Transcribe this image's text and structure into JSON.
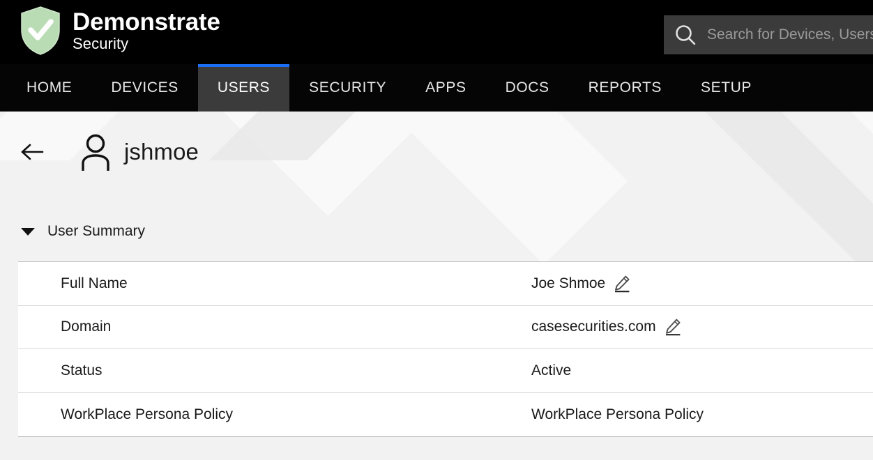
{
  "theme": {
    "accent": "#1c6ef2",
    "header_bg": "#000000",
    "nav_active_bg": "#3b3b3b",
    "shield_green": "#b9dcb4",
    "page_bg": "#f2f2f2",
    "table_bg": "#ffffff"
  },
  "header": {
    "brand_title": "Demonstrate",
    "brand_subtitle": "Security",
    "logo_icon": "shield-check-icon",
    "search": {
      "icon": "search-icon",
      "placeholder": "Search for Devices, Users, Apps...",
      "value": ""
    }
  },
  "nav": {
    "items": [
      {
        "label": "HOME",
        "key": "home",
        "active": false
      },
      {
        "label": "DEVICES",
        "key": "devices",
        "active": false
      },
      {
        "label": "USERS",
        "key": "users",
        "active": true
      },
      {
        "label": "SECURITY",
        "key": "security",
        "active": false
      },
      {
        "label": "APPS",
        "key": "apps",
        "active": false
      },
      {
        "label": "DOCS",
        "key": "docs",
        "active": false
      },
      {
        "label": "REPORTS",
        "key": "reports",
        "active": false
      },
      {
        "label": "SETUP",
        "key": "setup",
        "active": false
      }
    ]
  },
  "page": {
    "back_icon": "arrow-left-icon",
    "avatar_icon": "user-avatar-icon",
    "user_name": "jshmoe",
    "section": {
      "caret_icon": "caret-down-icon",
      "title": "User Summary",
      "expanded": true
    },
    "summary_rows": [
      {
        "label": "Full Name",
        "value": "Joe Shmoe",
        "editable": true,
        "edit_icon": "pencil-edit-icon"
      },
      {
        "label": "Domain",
        "value": "casesecurities.com",
        "editable": true,
        "edit_icon": "pencil-edit-icon"
      },
      {
        "label": "Status",
        "value": "Active",
        "editable": false,
        "edit_icon": ""
      },
      {
        "label": "WorkPlace Persona Policy",
        "value": "WorkPlace Persona Policy",
        "editable": false,
        "edit_icon": ""
      }
    ]
  }
}
